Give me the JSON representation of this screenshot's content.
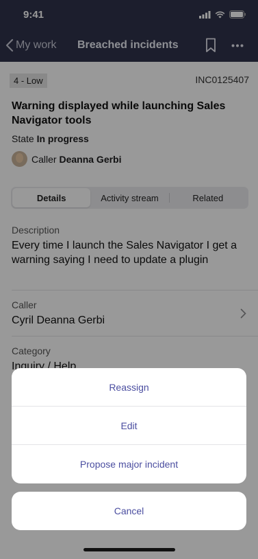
{
  "status_bar": {
    "time": "9:41"
  },
  "nav": {
    "back_label": "My work",
    "title": "Breached incidents"
  },
  "incident": {
    "priority": "4 - Low",
    "number": "INC0125407",
    "title": "Warning displayed while launching Sales Navigator tools",
    "state_label": "State",
    "state_value": "In progress",
    "caller_label": "Caller",
    "caller_name": "Deanna Gerbi"
  },
  "tabs": [
    {
      "label": "Details",
      "active": true
    },
    {
      "label": "Activity stream",
      "active": false
    },
    {
      "label": "Related",
      "active": false
    }
  ],
  "fields": {
    "description_label": "Description",
    "description_value": "Every time I launch the Sales Navigator I get a warning saying I need to update a plugin",
    "caller_label": "Caller",
    "caller_value": "Cyril Deanna Gerbi",
    "category_label": "Category",
    "category_value": "Inquiry / Help"
  },
  "action_sheet": {
    "items": [
      "Reassign",
      "Edit",
      "Propose major incident"
    ],
    "cancel": "Cancel"
  },
  "colors": {
    "nav_bg": "#30334b",
    "action_text": "#4b4ea0",
    "overlay": "rgba(0,0,0,0.4)"
  }
}
